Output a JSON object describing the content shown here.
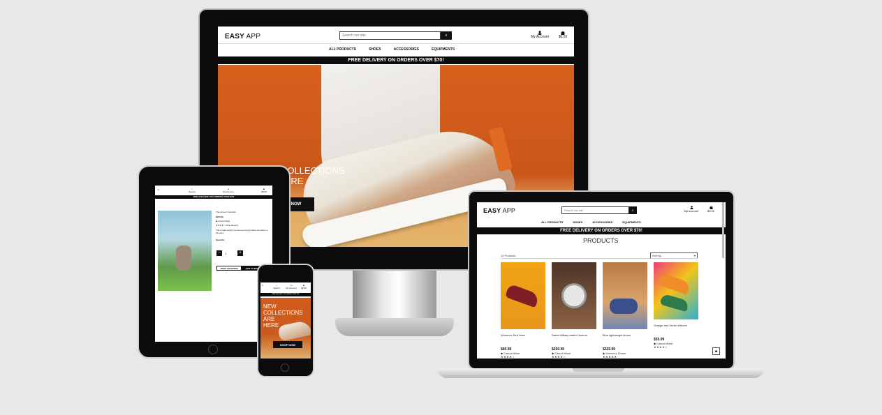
{
  "site": {
    "logo_bold": "EASY",
    "logo_rest": " APP",
    "search_placeholder": "Search our site",
    "my_account": "My Account",
    "cart_total": "$0.00",
    "nav": [
      "ALL PRODUCTS",
      "SHOES",
      "ACCESSORIES",
      "EQUIPMENTS"
    ],
    "promo": "FREE DELIVERY ON ORDERS OVER $70!"
  },
  "desktop": {
    "hero_title_line1": "NEW COLLECTIONS",
    "hero_title_line2": "ARE HERE",
    "hero_button": "SHOP NOW",
    "hero_button_visible": "NOW"
  },
  "laptop": {
    "page_title": "PRODUCTS",
    "count": "12 Products",
    "sort_label": "Sort by...",
    "products": [
      {
        "name": "Women's Red Vans",
        "price": "$60.99",
        "category": "Casual Wear",
        "color": "#e9a01f"
      },
      {
        "name": "Swiss Military watch Homme",
        "price": "$250.99",
        "category": "Casual Wear",
        "color": "#6b4a34"
      },
      {
        "name": "Blue lightweight shoes",
        "price": "$325.99",
        "category": "Women's Shoes",
        "color": "#c9874a"
      },
      {
        "name": "Orange and Green Airforce",
        "price": "$55.99",
        "category": "Casual Wear",
        "color": "#f2c419"
      }
    ]
  },
  "tablet": {
    "menu_label": "≡",
    "search_label": "Search",
    "account_label": "My Account",
    "cart_total": "$0.00",
    "promo": "FREE DELIVERY ON ORDERS OVER $70!",
    "product_name": "The Jomen's Sandals",
    "product_price": "$250.99",
    "product_category": "Casual Wear",
    "review_text": "Write Review",
    "description": "This is light weight yet strong enough shoes for ladies in the yard.",
    "quantity_label": "Quantity",
    "quantity_value": "1",
    "keep_shopping": "KEEP SHOPPING",
    "add_to_bag": "ADD TO BAG"
  },
  "phone": {
    "search_label": "Search",
    "account_label": "My Account",
    "cart_total": "$0.00",
    "promo": "FREE DELIVERY ON ORDERS OVER $70!",
    "hero_title_line1": "NEW",
    "hero_title_line2": "COLLECTIONS",
    "hero_title_line3": "ARE",
    "hero_title_line4": "HERE",
    "hero_button": "SHOP NOW"
  }
}
